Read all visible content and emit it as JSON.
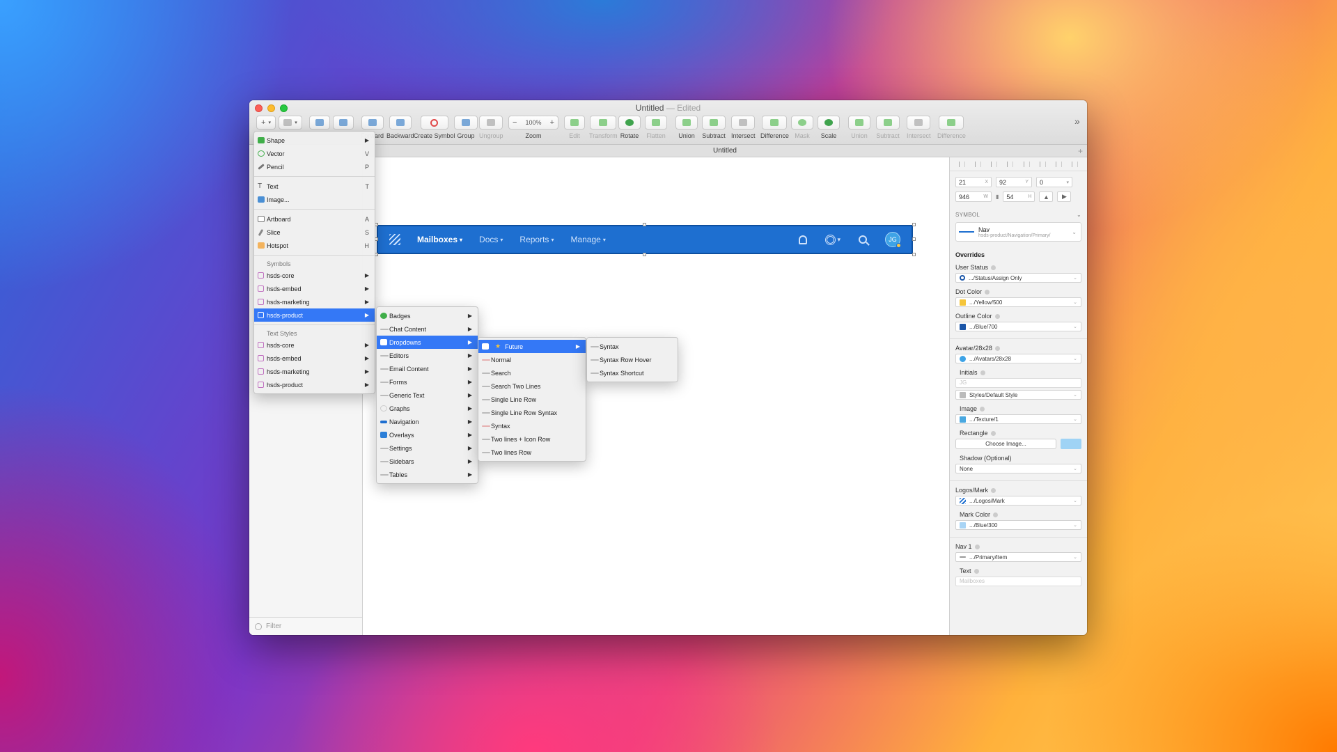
{
  "window": {
    "title": "Untitled",
    "title_suffix": "— Edited",
    "tab_title": "Untitled",
    "tab_plus": "+"
  },
  "toolbar": {
    "insert_label": "+",
    "buttons": [
      {
        "label": "Forward"
      },
      {
        "label": "Backward"
      },
      {
        "label": "Create Symbol"
      },
      {
        "label": "Group"
      },
      {
        "label": "Ungroup"
      },
      {
        "label": "Zoom"
      },
      {
        "label": "Edit"
      },
      {
        "label": "Transform"
      },
      {
        "label": "Rotate"
      },
      {
        "label": "Flatten"
      },
      {
        "label": "Union"
      },
      {
        "label": "Subtract"
      },
      {
        "label": "Intersect"
      },
      {
        "label": "Difference"
      },
      {
        "label": "Mask"
      },
      {
        "label": "Scale"
      },
      {
        "label": "Union"
      },
      {
        "label": "Subtract"
      },
      {
        "label": "Intersect"
      },
      {
        "label": "Difference"
      }
    ],
    "zoom_minus": "−",
    "zoom_value": "100%",
    "zoom_plus": "+",
    "overflow": "»"
  },
  "insert_menu": {
    "shape": {
      "label": "Shape"
    },
    "vector": {
      "label": "Vector",
      "shortcut": "V"
    },
    "pencil": {
      "label": "Pencil",
      "shortcut": "P"
    },
    "text": {
      "label": "Text",
      "shortcut": "T"
    },
    "image": {
      "label": "Image..."
    },
    "artboard": {
      "label": "Artboard",
      "shortcut": "A"
    },
    "slice": {
      "label": "Slice",
      "shortcut": "S"
    },
    "hotspot": {
      "label": "Hotspot",
      "shortcut": "H"
    },
    "symbols_header": "Symbols",
    "symbols": [
      "hsds-core",
      "hsds-embed",
      "hsds-marketing",
      "hsds-product"
    ],
    "text_styles_header": "Text Styles",
    "text_styles": [
      "hsds-core",
      "hsds-embed",
      "hsds-marketing",
      "hsds-product"
    ]
  },
  "product_menu": [
    "Badges",
    "Chat Content",
    "Dropdowns",
    "Editors",
    "Email Content",
    "Forms",
    "Generic Text",
    "Graphs",
    "Navigation",
    "Overlays",
    "Settings",
    "Sidebars",
    "Tables"
  ],
  "dropdowns_menu": [
    "Future",
    "Normal",
    "Search",
    "Search Two Lines",
    "Single Line Row",
    "Single Line Row Syntax",
    "Syntax",
    "Two lines + Icon Row",
    "Two lines Row"
  ],
  "future_menu": [
    "Syntax",
    "Syntax Row Hover",
    "Syntax Shortcut"
  ],
  "filter": {
    "placeholder": "Filter"
  },
  "nav": {
    "items": [
      "Mailboxes",
      "Docs",
      "Reports",
      "Manage"
    ],
    "avatar_initials": "JG"
  },
  "inspector": {
    "x": "21",
    "x_unit": "X",
    "y": "92",
    "y_unit": "Y",
    "rotation": "0",
    "w": "946",
    "w_unit": "W",
    "h": "54",
    "h_unit": "H",
    "symbol_header": "SYMBOL",
    "symbol_name": "Nav",
    "symbol_path": "hsds-product/Navigation/Primary/",
    "overrides_title": "Overrides",
    "overrides": {
      "user_status": {
        "label": "User Status",
        "value": ".../Status/Assign Only"
      },
      "dot_color": {
        "label": "Dot Color",
        "value": ".../Yellow/500",
        "color": "#f5c53b"
      },
      "outline_color": {
        "label": "Outline Color",
        "value": ".../Blue/700",
        "color": "#1b56a8"
      },
      "avatar": {
        "label": "Avatar/28x28",
        "value": ".../Avatars/28x28"
      },
      "initials": {
        "label": "Initials",
        "placeholder": "JG"
      },
      "initials_style": {
        "value": "Styles/Default Style"
      },
      "image": {
        "label": "Image",
        "value": ".../Texture/1"
      },
      "rectangle": {
        "label": "Rectangle",
        "button": "Choose Image..."
      },
      "shadow": {
        "label": "Shadow (Optional)",
        "value": "None"
      },
      "logos_mark": {
        "label": "Logos/Mark",
        "value": ".../Logos/Mark"
      },
      "mark_color": {
        "label": "Mark Color",
        "value": ".../Blue/300",
        "color": "#a8d4f5"
      },
      "nav1": {
        "label": "Nav 1",
        "value": ".../Primary/Item"
      },
      "text": {
        "label": "Text",
        "placeholder": "Mailboxes"
      }
    }
  }
}
